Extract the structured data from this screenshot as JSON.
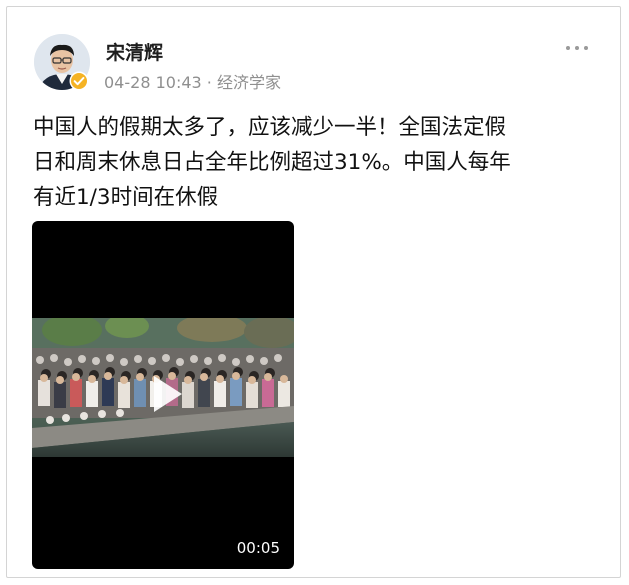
{
  "post": {
    "author": {
      "name": "宋清辉",
      "verified": true,
      "avatar": "avatar-man-glasses"
    },
    "timestamp": "04-28 10:43",
    "meta_separator": " · ",
    "author_title": "经济学家",
    "more_icon": "more-dots-icon",
    "text_lines": [
      "中国人的假期太多了，应该减少一半！全国法定假",
      "日和周末休息日占全年比例超过31%。中国人每年",
      "有近1/3时间在休假"
    ],
    "video": {
      "duration": "00:05",
      "play_icon": "play-icon",
      "thumbnail": "crowd-by-river-photo"
    }
  },
  "colors": {
    "name": "#1e1e1e",
    "meta": "#8f8f8f",
    "text": "#111111",
    "verified": "#f5b324",
    "video_bg": "#000000"
  }
}
